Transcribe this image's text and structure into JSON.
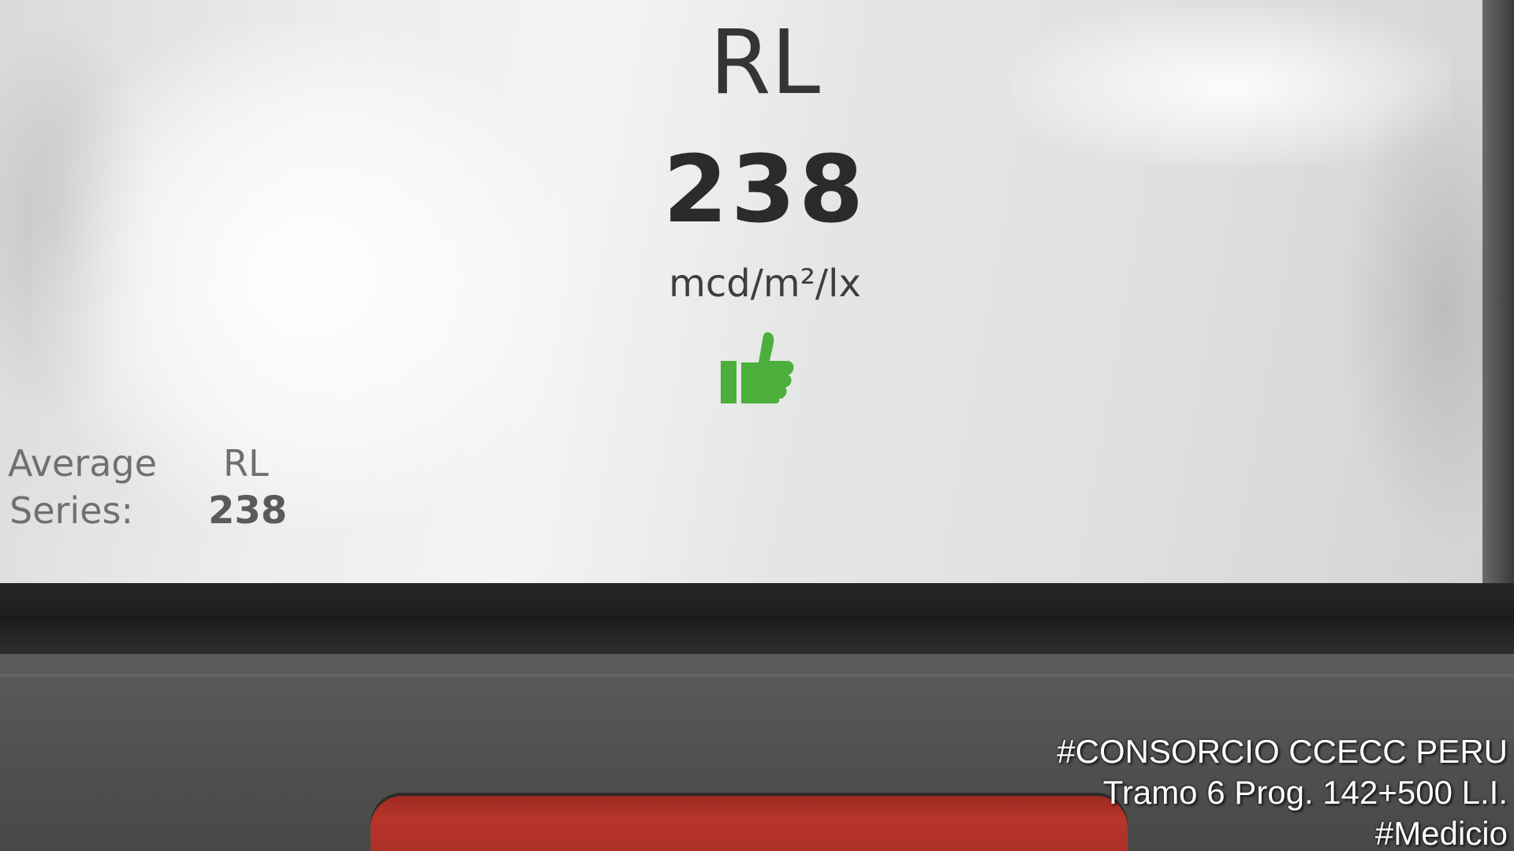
{
  "display": {
    "parameter_label": "RL",
    "value": "238",
    "unit": "mcd/m²/lx",
    "result_icon": "thumbs-up-icon",
    "result_color": "#4caf3c"
  },
  "average": {
    "label_line1": "Average",
    "label_line2": "Series:",
    "parameter_label": "RL",
    "value": "238"
  },
  "watermark": {
    "line1": "#CONSORCIO CCECC PERU",
    "line2": "Tramo 6 Prog. 142+500 L.I.",
    "line3": "#Medicio"
  },
  "device": {
    "button_color": "#b8352a"
  }
}
